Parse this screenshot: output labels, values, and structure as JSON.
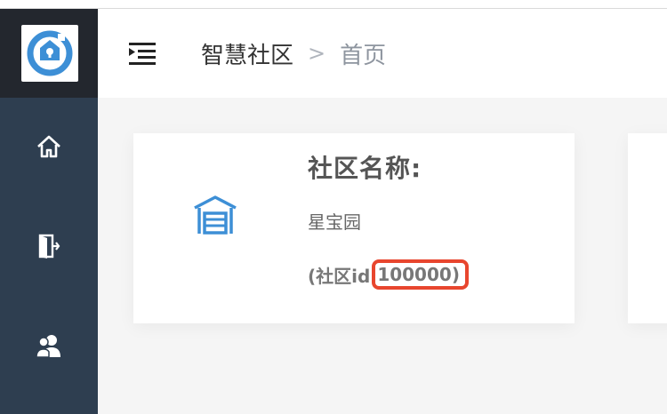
{
  "app": {
    "logo_icon": "home-circle-logo-icon",
    "accent_color": "#3d8fd6",
    "highlight_color": "#e8462e"
  },
  "sidebar": {
    "items": [
      {
        "icon": "home-icon"
      },
      {
        "icon": "door-exit-icon"
      },
      {
        "icon": "users-icon"
      }
    ]
  },
  "header": {
    "menu_toggle_icon": "menu-indent-icon",
    "breadcrumb": {
      "root": "智慧社区",
      "separator": ">",
      "current": "首页"
    }
  },
  "community_card": {
    "icon": "garage-building-icon",
    "title": "社区名称:",
    "name": "星宝园",
    "id_prefix": "(社区id:",
    "id_value": "100000",
    "id_suffix": ")"
  }
}
